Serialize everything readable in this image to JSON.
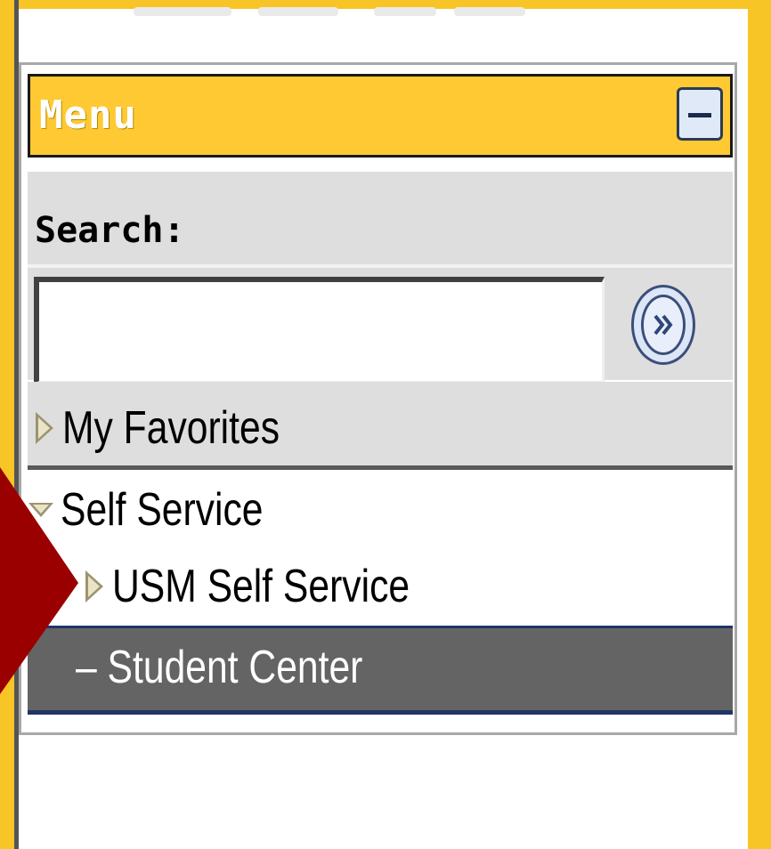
{
  "colors": {
    "frame": "#f7c525",
    "header_bg": "#fec933",
    "selected_bg": "#646464",
    "arrow": "#9b0000"
  },
  "menu": {
    "title": "Menu",
    "collapse_icon": "minus-icon"
  },
  "search": {
    "label": "Search:",
    "value": "",
    "go_icon": "double-chevron-right-icon"
  },
  "nav": {
    "favorites": "My Favorites",
    "self_service": "Self Service",
    "usm_self_service": "USM Self Service",
    "student_center": "– Student Center"
  }
}
